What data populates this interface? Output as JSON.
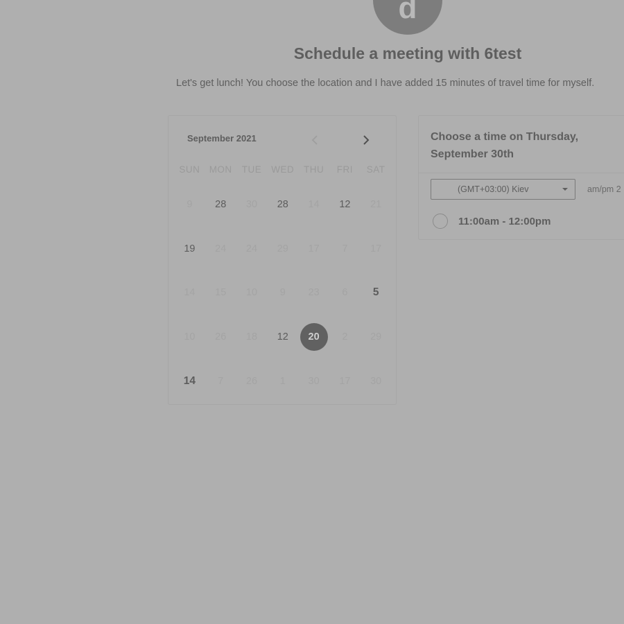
{
  "host": {
    "avatar_initial": "d",
    "title": "Schedule a meeting with 6test",
    "description": "Let's get lunch! You choose the location and I have added 15 minutes of travel time for myself."
  },
  "calendar": {
    "month_label": "September 2021",
    "prev_label": "previous month",
    "next_label": "next month",
    "weekdays": [
      "SUN",
      "MON",
      "TUE",
      "WED",
      "THU",
      "FRI",
      "SAT"
    ],
    "weeks": [
      [
        {
          "d": "9",
          "s": "off"
        },
        {
          "d": "28",
          "s": "on"
        },
        {
          "d": "30",
          "s": "off"
        },
        {
          "d": "28",
          "s": "on"
        },
        {
          "d": "14",
          "s": "off"
        },
        {
          "d": "12",
          "s": "on"
        },
        {
          "d": "21",
          "s": "off"
        }
      ],
      [
        {
          "d": "19",
          "s": "on"
        },
        {
          "d": "24",
          "s": "off"
        },
        {
          "d": "24",
          "s": "off"
        },
        {
          "d": "29",
          "s": "off"
        },
        {
          "d": "17",
          "s": "off"
        },
        {
          "d": "7",
          "s": "off"
        },
        {
          "d": "17",
          "s": "off"
        }
      ],
      [
        {
          "d": "14",
          "s": "off"
        },
        {
          "d": "15",
          "s": "off"
        },
        {
          "d": "10",
          "s": "off"
        },
        {
          "d": "9",
          "s": "off"
        },
        {
          "d": "23",
          "s": "off"
        },
        {
          "d": "6",
          "s": "off"
        },
        {
          "d": "5",
          "s": "bold"
        }
      ],
      [
        {
          "d": "10",
          "s": "off"
        },
        {
          "d": "26",
          "s": "off"
        },
        {
          "d": "18",
          "s": "off"
        },
        {
          "d": "12",
          "s": "on"
        },
        {
          "d": "20",
          "s": "selected"
        },
        {
          "d": "2",
          "s": "off"
        },
        {
          "d": "29",
          "s": "off"
        }
      ],
      [
        {
          "d": "14",
          "s": "bold"
        },
        {
          "d": "7",
          "s": "off"
        },
        {
          "d": "26",
          "s": "off"
        },
        {
          "d": "1",
          "s": "off"
        },
        {
          "d": "30",
          "s": "off"
        },
        {
          "d": "17",
          "s": "off"
        },
        {
          "d": "30",
          "s": "off"
        }
      ]
    ]
  },
  "times": {
    "heading": "Choose a time on Thursday, September 30th",
    "timezone": "(GMT+03:00) Kiev",
    "ampm_label": "am/pm",
    "ampm_value": "2",
    "slots": [
      {
        "label": "11:00am - 12:00pm"
      }
    ]
  },
  "colors": {
    "background": "#afafaf",
    "selected_day": "#616161",
    "avatar": "#7d7d7d"
  }
}
